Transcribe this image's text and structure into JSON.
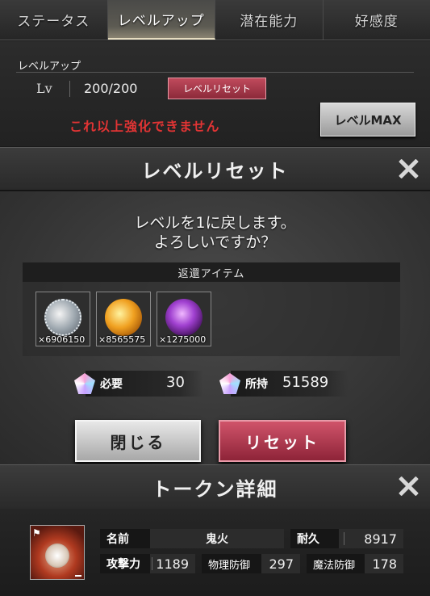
{
  "tabs": [
    {
      "label": "ステータス",
      "active": false
    },
    {
      "label": "レベルアップ",
      "active": true
    },
    {
      "label": "潜在能力",
      "active": false
    },
    {
      "label": "好感度",
      "active": false
    }
  ],
  "level_panel": {
    "title": "レベルアップ",
    "lv_label": "Lv",
    "lv_value": "200/200",
    "reset_chip_label": "レベルリセット",
    "warning": "これ以上強化できません",
    "max_button_label": "レベルMAX"
  },
  "reset_dialog": {
    "title": "レベルリセット",
    "message_line1": "レベルを1に戻します。",
    "message_line2": "よろしいですか？",
    "return_items_header": "返還アイテム",
    "items": [
      {
        "count": "×6906150",
        "icon": "silver-orb-icon"
      },
      {
        "count": "×8565575",
        "icon": "gold-orb-icon"
      },
      {
        "count": "×1275000",
        "icon": "purple-orb-icon"
      }
    ],
    "required_label": "必要",
    "required_value": "30",
    "owned_label": "所持",
    "owned_value": "51589",
    "close_button": "閉じる",
    "reset_button": "リセット"
  },
  "token_detail": {
    "title": "トークン詳細",
    "name_key": "名前",
    "name_value": "鬼火",
    "durability_key": "耐久",
    "durability_value": "8917",
    "attack_key": "攻撃力",
    "attack_value": "1189",
    "phys_def_key": "物理防御",
    "phys_def_value": "297",
    "mag_def_key": "魔法防御",
    "mag_def_value": "178"
  },
  "colors": {
    "accent_red": "#e23434",
    "reset_pink": "#c04a5c"
  }
}
